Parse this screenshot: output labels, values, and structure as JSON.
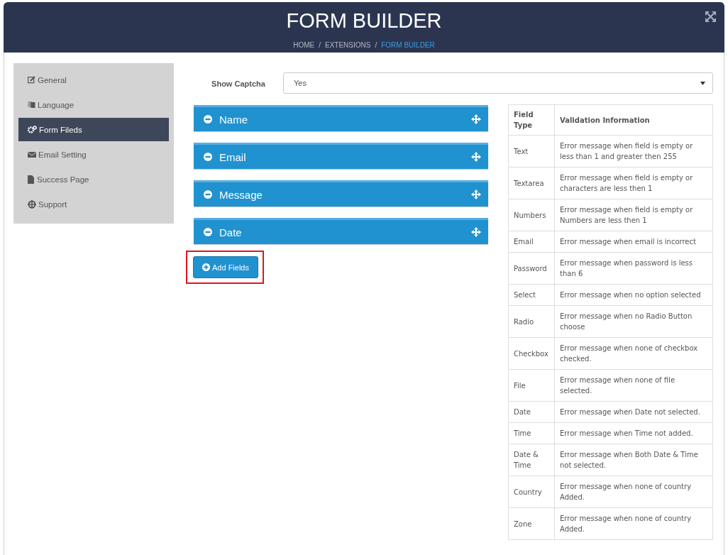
{
  "header": {
    "title": "FORM BUILDER",
    "breadcrumb": [
      {
        "label": "HOME",
        "current": false
      },
      {
        "separator": "/",
        "label": "EXTENSIONS",
        "current": false
      },
      {
        "separator": "/",
        "label": "FORM BUILDER",
        "current": true
      }
    ]
  },
  "sidebar": {
    "items": [
      {
        "label": "General",
        "selected": false
      },
      {
        "label": "Language",
        "selected": false
      },
      {
        "label": "Form Fileds",
        "selected": true
      },
      {
        "label": "Email Setting",
        "selected": false
      },
      {
        "label": "Success Page",
        "selected": false
      },
      {
        "label": "Support",
        "selected": false
      }
    ]
  },
  "captcha": {
    "label": "Show Captcha",
    "value": "Yes"
  },
  "fields": [
    {
      "label": "Name"
    },
    {
      "label": "Email"
    },
    {
      "label": "Message"
    },
    {
      "label": "Date"
    }
  ],
  "add_button": {
    "label": "Add Fields",
    "highlighted": true
  },
  "table": {
    "columns": [
      "Field Type",
      "Validation Information"
    ],
    "rows": [
      [
        "Text",
        "Error message when field is empty or less than 1 and greater then 255"
      ],
      [
        "Textarea",
        "Error message when field is empty or characters are less then 1"
      ],
      [
        "Numbers",
        "Error message when field is empty or Numbers are less then 1"
      ],
      [
        "Email",
        "Error message when email is incorrect"
      ],
      [
        "Password",
        "Error message when password is less than 6"
      ],
      [
        "Select",
        "Error message when no option selected"
      ],
      [
        "Radio",
        "Error message when no Radio Button choose"
      ],
      [
        "Checkbox",
        "Error message when none of checkbox checked."
      ],
      [
        "File",
        "Error message when none of file selected."
      ],
      [
        "Date",
        "Error message when Date not selected."
      ],
      [
        "Time",
        "Error message when Time not added."
      ],
      [
        "Date & Time",
        "Error message when Both Date & Time not selected."
      ],
      [
        "Country",
        "Error message when none of country Added."
      ],
      [
        "Zone",
        "Error message when none of country Added."
      ]
    ]
  }
}
